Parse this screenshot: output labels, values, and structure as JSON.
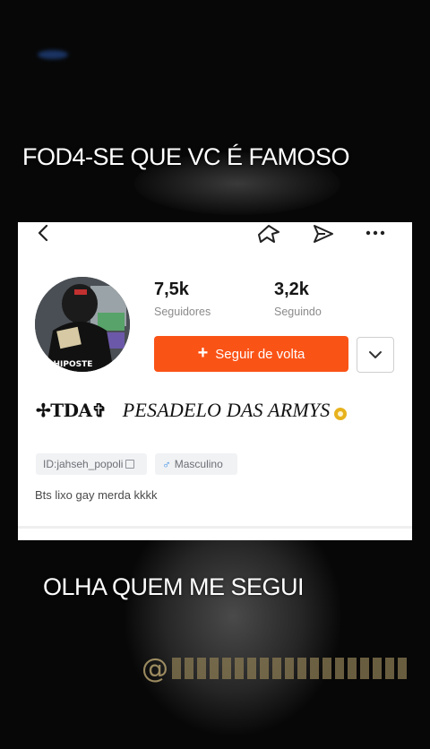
{
  "overlay": {
    "caption_top": "FOD4-SE QUE VC É FAMOSO",
    "caption_bottom": "OLHA QUEM ME SEGUI",
    "watermark_symbol": "@"
  },
  "profile": {
    "followers_count": "7,5k",
    "followers_label": "Seguidores",
    "following_count": "3,2k",
    "following_label": "Seguindo",
    "follow_button_label": "Seguir de volta",
    "follow_button_icon": "+",
    "clan_tag": "✢TDA✞",
    "display_name": "PESADELO DAS ARMYS",
    "user_id": "ID:jahseh_popoli",
    "gender": "Masculino",
    "gender_icon": "♂",
    "bio": "Bts lixo gay merda kkkk",
    "avatar_text": "SHIPOSTE"
  },
  "colors": {
    "accent": "#fa5316",
    "background": "#070707",
    "card": "#ffffff",
    "gender_icon": "#3a90e6",
    "badge": "#e7b21d"
  }
}
